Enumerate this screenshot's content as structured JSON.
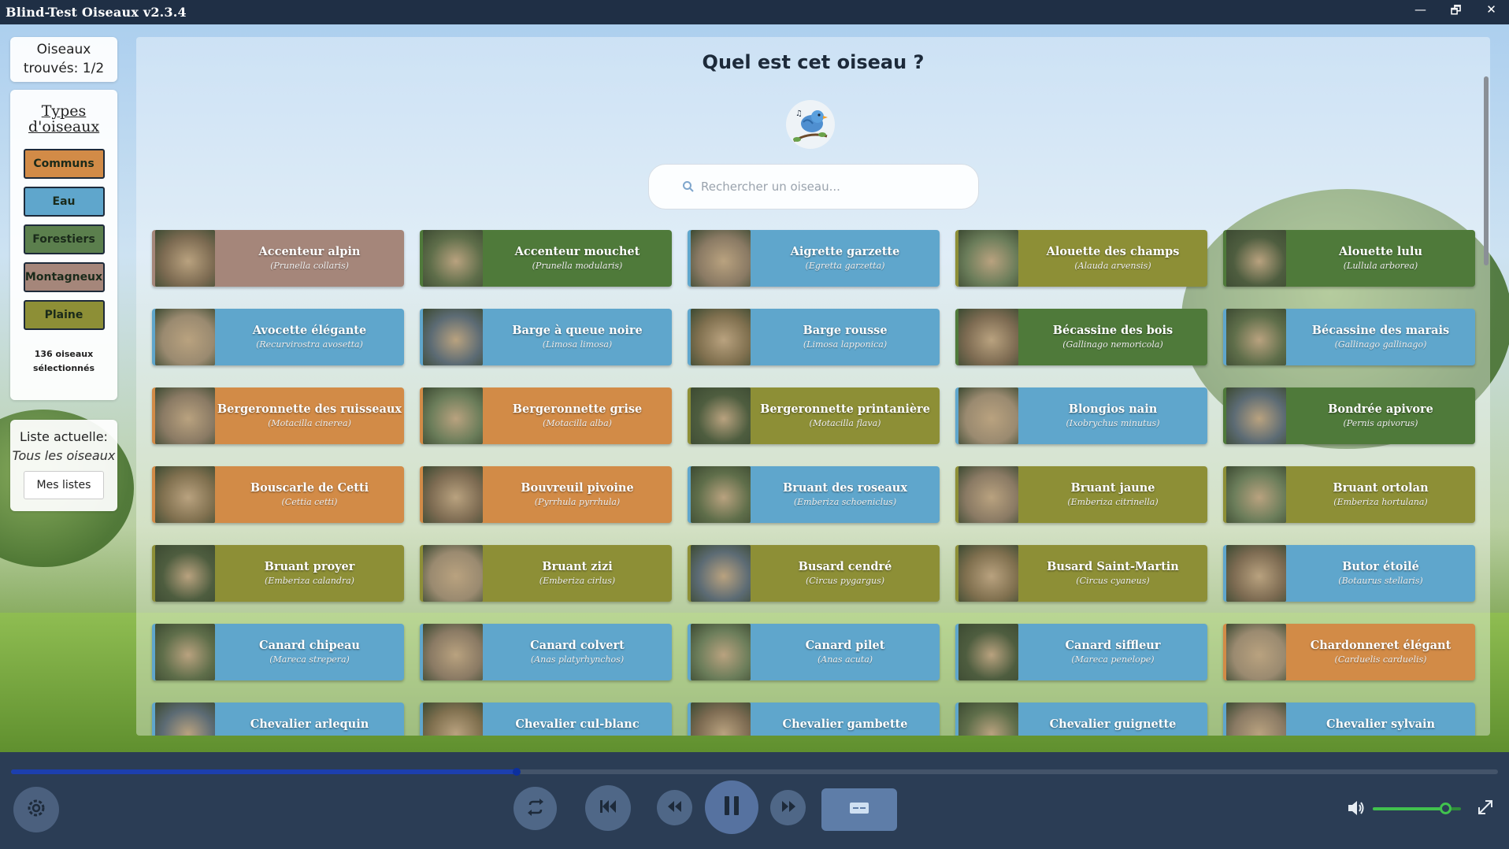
{
  "window": {
    "title": "Blind-Test Oiseaux v2.3.4",
    "min": "—",
    "restore": "🗗",
    "close": "✕"
  },
  "sidebar": {
    "found_line1": "Oiseaux",
    "found_line2": "trouvés: 1/2",
    "types_title": "Types d'oiseaux",
    "types": [
      "Communs",
      "Eau",
      "Forestiers",
      "Montagneux",
      "Plaine"
    ],
    "selected_line1": "136 oiseaux",
    "selected_line2": "sélectionnés",
    "list_label": "Liste actuelle:",
    "list_value": "Tous les oiseaux",
    "my_lists": "Mes listes"
  },
  "main": {
    "question": "Quel est cet oiseau ?",
    "search_placeholder": "Rechercher un oiseau..."
  },
  "colors": {
    "communs": "#d28b47",
    "eau": "#5fa6cc",
    "forestiers": "#4f7a3a",
    "montagneux": "#a5867a",
    "plaine": "#8d8f36"
  },
  "birds": [
    {
      "name": "Accenteur alpin",
      "latin": "(Prunella collaris)",
      "type": "montagneux"
    },
    {
      "name": "Accenteur mouchet",
      "latin": "(Prunella modularis)",
      "type": "forestiers"
    },
    {
      "name": "Aigrette garzette",
      "latin": "(Egretta garzetta)",
      "type": "eau"
    },
    {
      "name": "Alouette des champs",
      "latin": "(Alauda arvensis)",
      "type": "plaine"
    },
    {
      "name": "Alouette lulu",
      "latin": "(Lullula arborea)",
      "type": "forestiers"
    },
    {
      "name": "Avocette élégante",
      "latin": "(Recurvirostra avosetta)",
      "type": "eau"
    },
    {
      "name": "Barge à queue noire",
      "latin": "(Limosa limosa)",
      "type": "eau"
    },
    {
      "name": "Barge rousse",
      "latin": "(Limosa lapponica)",
      "type": "eau"
    },
    {
      "name": "Bécassine des bois",
      "latin": "(Gallinago nemoricola)",
      "type": "forestiers"
    },
    {
      "name": "Bécassine des marais",
      "latin": "(Gallinago gallinago)",
      "type": "eau"
    },
    {
      "name": "Bergeronnette des ruisseaux",
      "latin": "(Motacilla cinerea)",
      "type": "communs"
    },
    {
      "name": "Bergeronnette grise",
      "latin": "(Motacilla alba)",
      "type": "communs"
    },
    {
      "name": "Bergeronnette printanière",
      "latin": "(Motacilla flava)",
      "type": "plaine"
    },
    {
      "name": "Blongios nain",
      "latin": "(Ixobrychus minutus)",
      "type": "eau"
    },
    {
      "name": "Bondrée apivore",
      "latin": "(Pernis apivorus)",
      "type": "forestiers"
    },
    {
      "name": "Bouscarle de Cetti",
      "latin": "(Cettia cetti)",
      "type": "communs"
    },
    {
      "name": "Bouvreuil pivoine",
      "latin": "(Pyrrhula pyrrhula)",
      "type": "communs"
    },
    {
      "name": "Bruant des roseaux",
      "latin": "(Emberiza schoeniclus)",
      "type": "eau"
    },
    {
      "name": "Bruant jaune",
      "latin": "(Emberiza citrinella)",
      "type": "plaine"
    },
    {
      "name": "Bruant ortolan",
      "latin": "(Emberiza hortulana)",
      "type": "plaine"
    },
    {
      "name": "Bruant proyer",
      "latin": "(Emberiza calandra)",
      "type": "plaine"
    },
    {
      "name": "Bruant zizi",
      "latin": "(Emberiza cirlus)",
      "type": "plaine"
    },
    {
      "name": "Busard cendré",
      "latin": "(Circus pygargus)",
      "type": "plaine"
    },
    {
      "name": "Busard Saint-Martin",
      "latin": "(Circus cyaneus)",
      "type": "plaine"
    },
    {
      "name": "Butor étoilé",
      "latin": "(Botaurus stellaris)",
      "type": "eau"
    },
    {
      "name": "Canard chipeau",
      "latin": "(Mareca strepera)",
      "type": "eau"
    },
    {
      "name": "Canard colvert",
      "latin": "(Anas platyrhynchos)",
      "type": "eau"
    },
    {
      "name": "Canard pilet",
      "latin": "(Anas acuta)",
      "type": "eau"
    },
    {
      "name": "Canard siffleur",
      "latin": "(Mareca penelope)",
      "type": "eau"
    },
    {
      "name": "Chardonneret élégant",
      "latin": "(Carduelis carduelis)",
      "type": "communs"
    },
    {
      "name": "Chevalier arlequin",
      "latin": "",
      "type": "eau"
    },
    {
      "name": "Chevalier cul-blanc",
      "latin": "",
      "type": "eau"
    },
    {
      "name": "Chevalier gambette",
      "latin": "",
      "type": "eau"
    },
    {
      "name": "Chevalier guignette",
      "latin": "",
      "type": "eau"
    },
    {
      "name": "Chevalier sylvain",
      "latin": "",
      "type": "eau"
    }
  ],
  "player": {
    "progress": 0.34,
    "volume": 0.82
  }
}
